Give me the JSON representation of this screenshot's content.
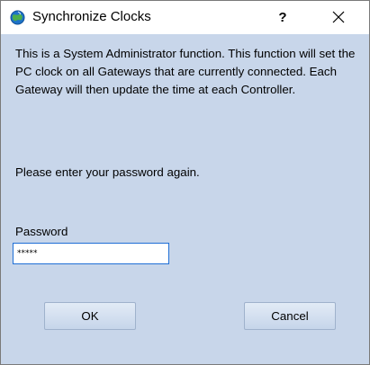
{
  "window": {
    "title": "Synchronize Clocks",
    "help_label": "?",
    "close_label": "✕"
  },
  "body": {
    "message": "This is a System Administrator function.  This function will set the PC clock on all Gateways that are currently connected.  Each Gateway will then update the time at each Controller.",
    "prompt": "Please enter your password again."
  },
  "password": {
    "label": "Password",
    "value": "*****"
  },
  "buttons": {
    "ok_label": "OK",
    "cancel_label": "Cancel"
  },
  "colors": {
    "dialog_background": "#c8d6ea",
    "titlebar_background": "#ffffff",
    "input_focus_border": "#1f6fd6"
  },
  "icons": {
    "app_icon": "app-globe-icon"
  }
}
